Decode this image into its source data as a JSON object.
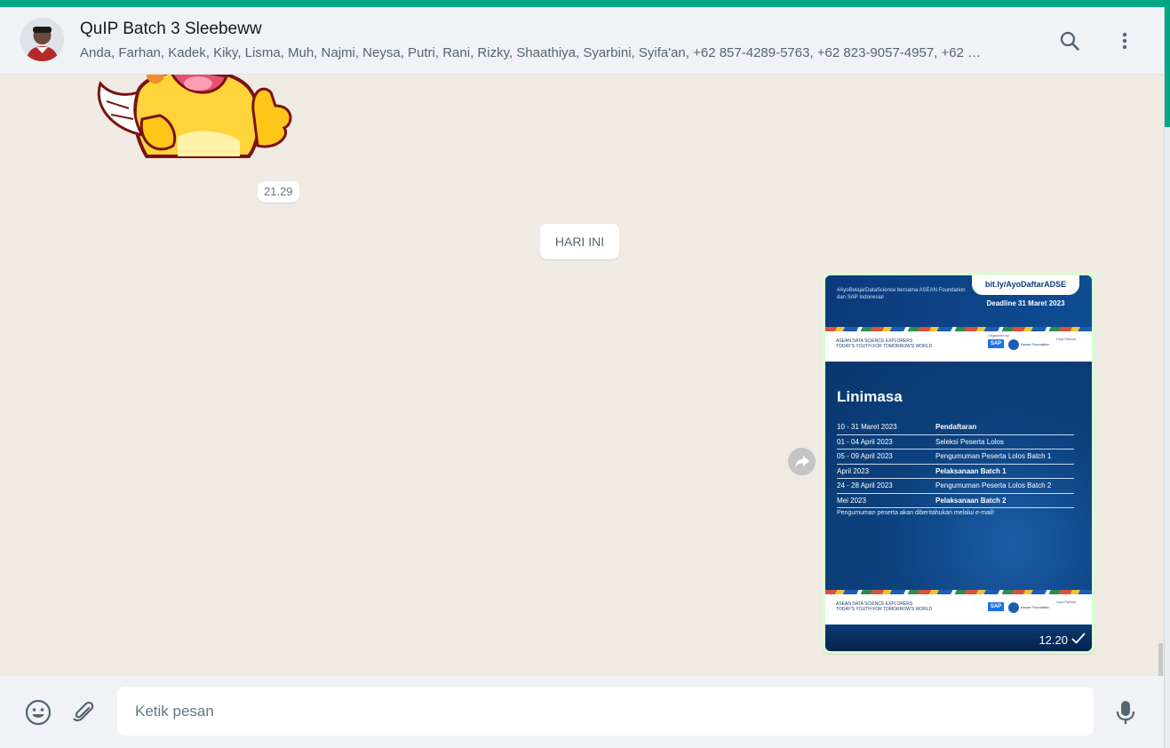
{
  "header": {
    "title": "QuIP Batch 3 Sleebeww",
    "members": "Anda, Farhan, Kadek, Kiky, Lisma, Muh, Najmi, Neysa, Putri, Rani, Rizky, Shaathiya, Syarbini, Syifa'an, +62 857-4289-5763, +62 823-9057-4957, +62 …",
    "icons": [
      "search-icon",
      "menu-icon"
    ]
  },
  "chat": {
    "sticker_time": "21.29",
    "day_label": "HARI INI",
    "image_message": {
      "time": "12.20",
      "status": "sent",
      "poster": {
        "hashtag": "#AyoBelajarDataScience bersama ASEAN Foundation dan SAP Indonesia!",
        "link": "bit.ly/AyoDaftarADSE",
        "deadline": "Deadline 31 Maret 2023",
        "logo_left": "ASEAN DATA SCIENCE EXPLORERS",
        "logo_left_sub": "TODAY'S YOUTH FOR TOMORROW'S WORLD",
        "organized_by": "Organized by",
        "sap": "SAP",
        "asean_foundation": "Asean Foundation",
        "host_partner": "Host Partner",
        "heading": "Linimasa",
        "rows": [
          {
            "date": "10 - 31 Maret 2023",
            "event": "Pendaftaran",
            "bold": true
          },
          {
            "date": "01 - 04 April 2023",
            "event": "Seleksi Peserta Lolos",
            "bold": false
          },
          {
            "date": "05 - 09 April 2023",
            "event": "Pengumuman Peserta Lolos Batch 1",
            "bold": false
          },
          {
            "date": "April 2023",
            "event": "Pelaksanaan Batch 1",
            "bold": true
          },
          {
            "date": "24 - 28 April 2023",
            "event": "Pengumuman Peserta Lolos Batch 2",
            "bold": false
          },
          {
            "date": "Mei 2023",
            "event": "Pelaksanaan Batch 2",
            "bold": true
          }
        ],
        "note": "Pengumuman peserta akan diberitahukan melalui e-mail!"
      }
    }
  },
  "composer": {
    "placeholder": "Ketik pesan",
    "icons": [
      "emoji-icon",
      "attach-icon",
      "mic-icon"
    ]
  },
  "colors": {
    "accent": "#00a884",
    "chat_bg": "#efeae2",
    "outgoing_bubble": "#d9fdd3",
    "poster_blue": "#0b3a7a"
  }
}
